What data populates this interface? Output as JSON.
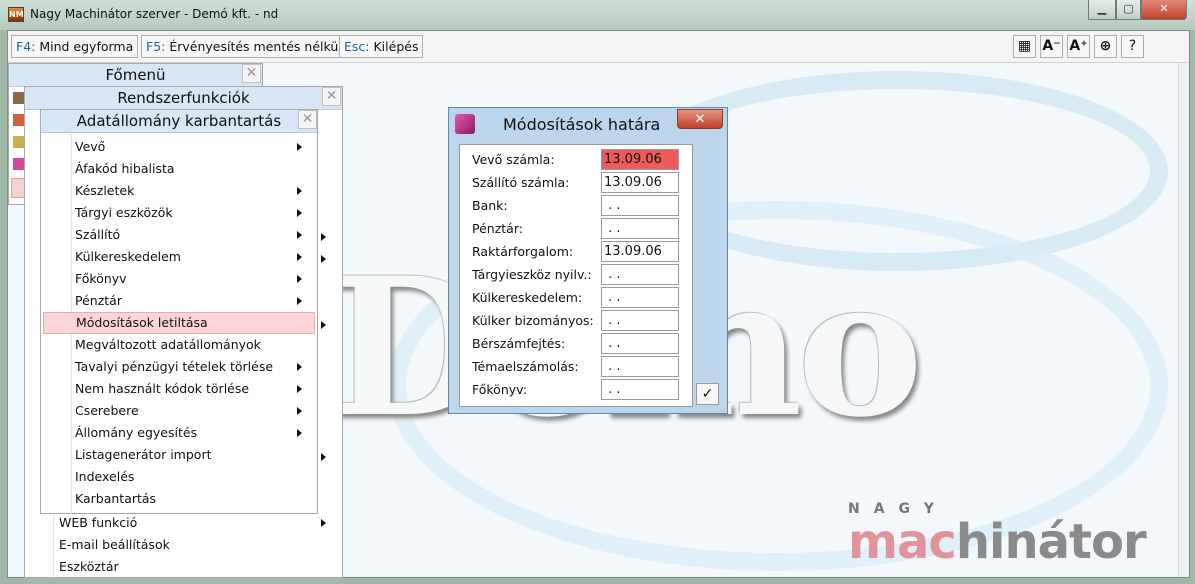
{
  "window": {
    "title": "Nagy Machinátor szerver - Demó kft. - nd",
    "app_icon": "NM",
    "minimize": "▁",
    "maximize": "▢",
    "close": "✕"
  },
  "toolbar": {
    "buttons": [
      {
        "key": "F4:",
        "label": "Mind egyforma"
      },
      {
        "key": "F5:",
        "label": "Érvényesítés mentés nélkül"
      },
      {
        "key": "Esc:",
        "label": "Kilépés"
      }
    ],
    "icon_buttons": [
      {
        "icon": "grid-icon",
        "glyph": "▦"
      },
      {
        "icon": "font-decrease-icon",
        "glyph": "A⁻"
      },
      {
        "icon": "font-increase-icon",
        "glyph": "A⁺"
      },
      {
        "icon": "navigate-icon",
        "glyph": "⊕"
      },
      {
        "icon": "help-icon",
        "glyph": "?"
      }
    ]
  },
  "watermark": "Demo",
  "fomenu": {
    "title": "Főmenü",
    "close": "✕"
  },
  "rendszer": {
    "title": "Rendszerfunkciók",
    "close": "✕",
    "items": [
      "WEB funkció",
      "E-mail beállítások",
      "Eszköztár"
    ]
  },
  "adat": {
    "title": "Adatállomány karbantartás",
    "close": "✕",
    "items": [
      "Vevő",
      "Áfakód hibalista",
      "Készletek",
      "Tárgyi eszközök",
      "Szállító",
      "Külkereskedelem",
      "Főkönyv",
      "Pénztár",
      "Módosítások letiltása",
      "Megváltozott adatállományok",
      "Tavalyi pénzügyi tételek törlése",
      "Nem használt kódok törlése",
      "Cserebere",
      "Állomány egyesítés",
      "Listagenerátor import",
      "Indexelés",
      "Karbantartás"
    ],
    "selected": "Módosítások letiltása"
  },
  "dialog": {
    "title": "Módosítások határa",
    "close": "✕",
    "ok": "✓",
    "fields": [
      {
        "label": "Vevő számla:",
        "value": "13.09.06"
      },
      {
        "label": "Szállító számla:",
        "value": "13.09.06"
      },
      {
        "label": "Bank:",
        "value": " . ."
      },
      {
        "label": "Pénztár:",
        "value": " . ."
      },
      {
        "label": "Raktárforgalom:",
        "value": "13.09.06"
      },
      {
        "label": "Tárgyieszköz nyilv.:",
        "value": " . ."
      },
      {
        "label": "Külkereskedelem:",
        "value": " . ."
      },
      {
        "label": "Külker bizományos:",
        "value": " . ."
      },
      {
        "label": "Bérszámfejtés:",
        "value": " . ."
      },
      {
        "label": "Témaelszámolás:",
        "value": " . ."
      },
      {
        "label": "Főkönyv:",
        "value": " . ."
      }
    ]
  },
  "logo": {
    "top": "NAGY",
    "part1": "mac",
    "part2": "hinátor",
    "color1": "#e0939a",
    "color2": "#8a8a8a"
  }
}
